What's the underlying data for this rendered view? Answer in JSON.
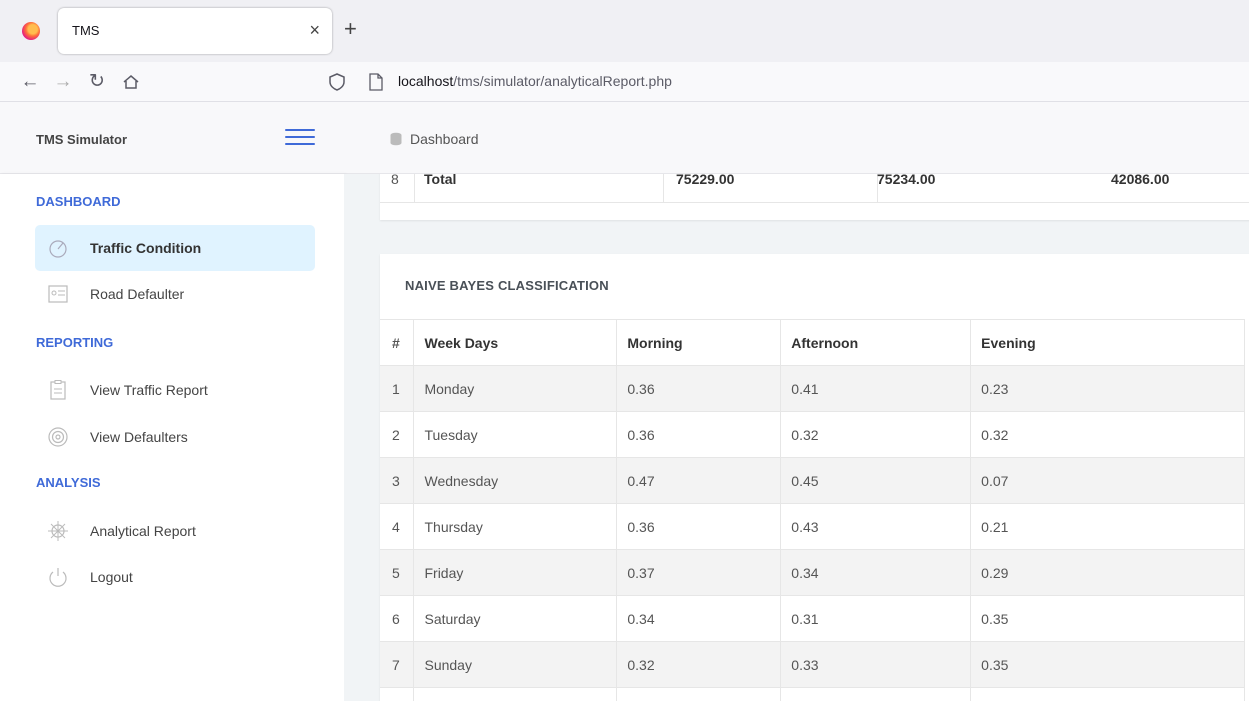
{
  "browser": {
    "tab_title": "TMS",
    "url_host": "localhost",
    "url_path": "/tms/simulator/analyticalReport.php"
  },
  "header": {
    "brand": "TMS Simulator",
    "breadcrumb": "Dashboard"
  },
  "sidebar": {
    "sections": [
      {
        "label": "DASHBOARD"
      },
      {
        "label": "REPORTING"
      },
      {
        "label": "ANALYSIS"
      }
    ],
    "items": [
      {
        "label": "Traffic Condition",
        "icon": "gauge-icon",
        "active": true
      },
      {
        "label": "Road Defaulter",
        "icon": "id-card-icon"
      },
      {
        "label": "View Traffic Report",
        "icon": "clipboard-icon"
      },
      {
        "label": "View Defaulters",
        "icon": "target-icon"
      },
      {
        "label": "Analytical Report",
        "icon": "helm-icon"
      },
      {
        "label": "Logout",
        "icon": "power-icon"
      }
    ]
  },
  "totals_row": {
    "index": "8",
    "label": "Total",
    "values": [
      "75229.00",
      "75234.00",
      "42086.00"
    ]
  },
  "naive_bayes": {
    "title": "NAIVE BAYES CLASSIFICATION",
    "headers": [
      "#",
      "Week Days",
      "Morning",
      "Afternoon",
      "Evening"
    ],
    "rows": [
      [
        "1",
        "Monday",
        "0.36",
        "0.41",
        "0.23"
      ],
      [
        "2",
        "Tuesday",
        "0.36",
        "0.32",
        "0.32"
      ],
      [
        "3",
        "Wednesday",
        "0.47",
        "0.45",
        "0.07"
      ],
      [
        "4",
        "Thursday",
        "0.36",
        "0.43",
        "0.21"
      ],
      [
        "5",
        "Friday",
        "0.37",
        "0.34",
        "0.29"
      ],
      [
        "6",
        "Saturday",
        "0.34",
        "0.31",
        "0.35"
      ],
      [
        "7",
        "Sunday",
        "0.32",
        "0.33",
        "0.35"
      ]
    ]
  },
  "colors": {
    "accent": "#3f6ad8",
    "active_bg": "#e0f3ff"
  }
}
